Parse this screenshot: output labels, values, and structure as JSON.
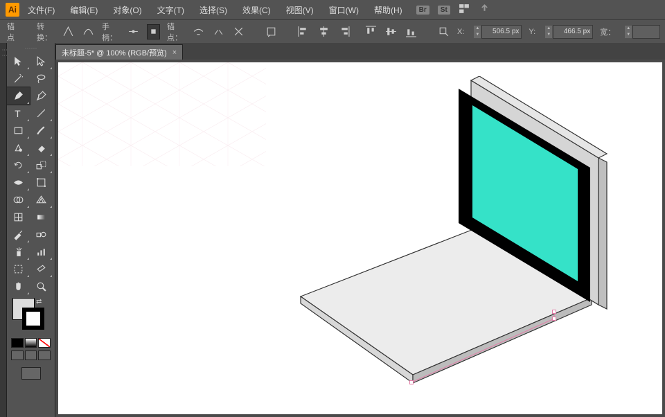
{
  "app": {
    "logo": "Ai"
  },
  "menu": {
    "items": [
      "文件(F)",
      "编辑(E)",
      "对象(O)",
      "文字(T)",
      "选择(S)",
      "效果(C)",
      "视图(V)",
      "窗口(W)",
      "帮助(H)"
    ],
    "badges": [
      "Br",
      "St"
    ]
  },
  "controls": {
    "anchor_label": "锚点",
    "convert_label": "转换：",
    "handle_label": "手柄：",
    "anchor2_label": "锚点：",
    "x_label": "X:",
    "x_value": "506.5 px",
    "y_label": "Y:",
    "y_value": "466.5 px",
    "w_label": "宽："
  },
  "doc": {
    "tab_title": "未标题-5* @ 100% (RGB/预览)",
    "close": "×"
  },
  "tools": {
    "names": [
      [
        "selection",
        "direct-selection"
      ],
      [
        "magic-wand",
        "lasso"
      ],
      [
        "pen",
        "curvature"
      ],
      [
        "type",
        "line"
      ],
      [
        "rectangle",
        "paintbrush"
      ],
      [
        "shaper",
        "eraser"
      ],
      [
        "rotate",
        "scale"
      ],
      [
        "width",
        "free-transform"
      ],
      [
        "shape-builder",
        "perspective"
      ],
      [
        "mesh",
        "gradient"
      ],
      [
        "eyedropper",
        "blend"
      ],
      [
        "symbol-sprayer",
        "graph"
      ],
      [
        "artboard",
        "slice"
      ],
      [
        "hand",
        "zoom"
      ]
    ]
  }
}
